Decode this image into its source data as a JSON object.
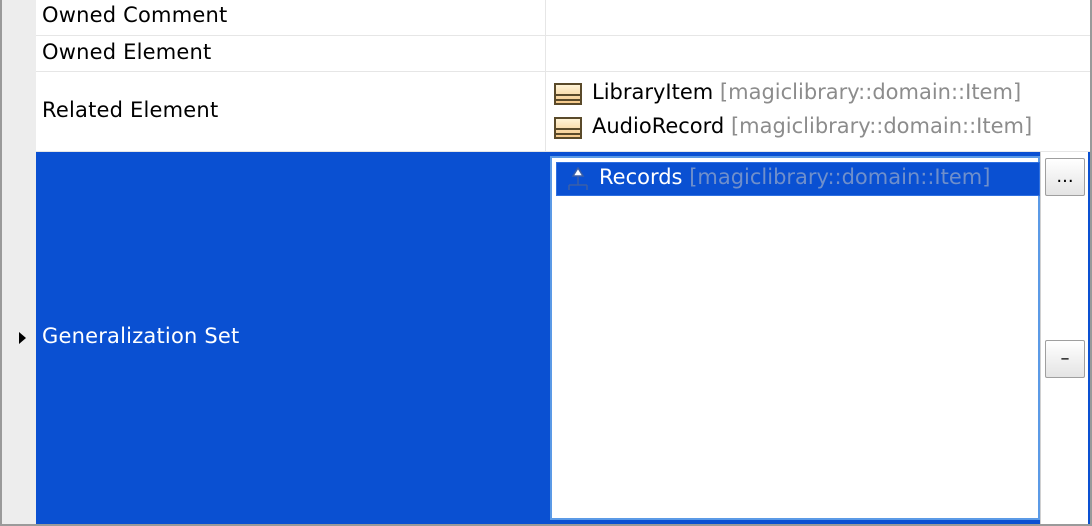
{
  "rows": [
    {
      "name": "Owned Comment",
      "values": []
    },
    {
      "name": "Owned Element",
      "values": []
    },
    {
      "name": "Related Element",
      "values": [
        {
          "name": "LibraryItem",
          "qualifier": "[magiclibrary::domain::Item]",
          "icon": "class-icon"
        },
        {
          "name": "AudioRecord",
          "qualifier": "[magiclibrary::domain::Item]",
          "icon": "class-icon"
        }
      ]
    },
    {
      "name": "Generalization Set",
      "selected": true,
      "values": [
        {
          "name": "Records",
          "qualifier": "[magiclibrary::domain::Item]",
          "icon": "generalization-set-icon"
        }
      ],
      "buttons": {
        "more_label": "...",
        "remove_label": "–"
      }
    }
  ],
  "colors": {
    "selection": "#0a50d2",
    "qualifier_text": "#8c8c8c",
    "list_border": "#5b9ae6"
  }
}
